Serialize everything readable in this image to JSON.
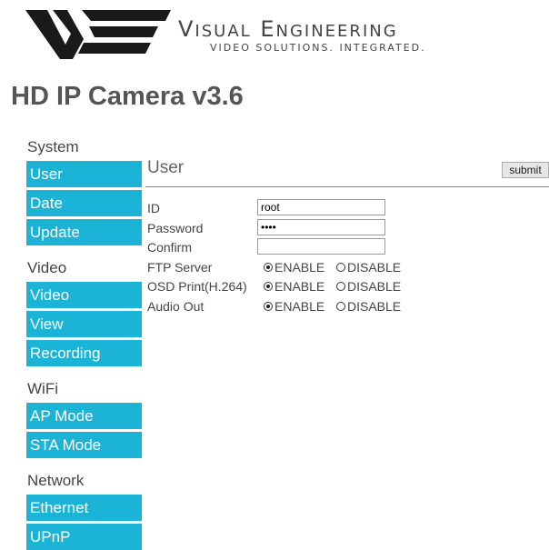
{
  "brand": {
    "name_first": "V",
    "name_first_rest": "isual",
    "name_second": "E",
    "name_second_rest": "ngineering",
    "tagline": "VIDEO SOLUTIONS. INTEGRATED."
  },
  "page_title": "HD IP Camera v3.6",
  "sidebar": {
    "groups": [
      {
        "heading": "System",
        "items": [
          "User",
          "Date",
          "Update"
        ]
      },
      {
        "heading": "Video",
        "items": [
          "Video",
          "View",
          "Recording"
        ]
      },
      {
        "heading": "WiFi",
        "items": [
          "AP Mode",
          "STA Mode"
        ]
      },
      {
        "heading": "Network",
        "items": [
          "Ethernet",
          "UPnP"
        ]
      }
    ]
  },
  "section": {
    "title": "User",
    "submit_label": "submit"
  },
  "form": {
    "id_label": "ID",
    "id_value": "root",
    "password_label": "Password",
    "password_value": "abcd",
    "confirm_label": "Confirm",
    "confirm_value": "",
    "ftp_label": "FTP Server",
    "osd_label": "OSD Print(H.264)",
    "audio_label": "Audio Out",
    "enable_label": "ENABLE",
    "disable_label": "DISABLE",
    "ftp_value": "ENABLE",
    "osd_value": "ENABLE",
    "audio_value": "ENABLE"
  },
  "colors": {
    "accent": "#1cb4d6"
  }
}
